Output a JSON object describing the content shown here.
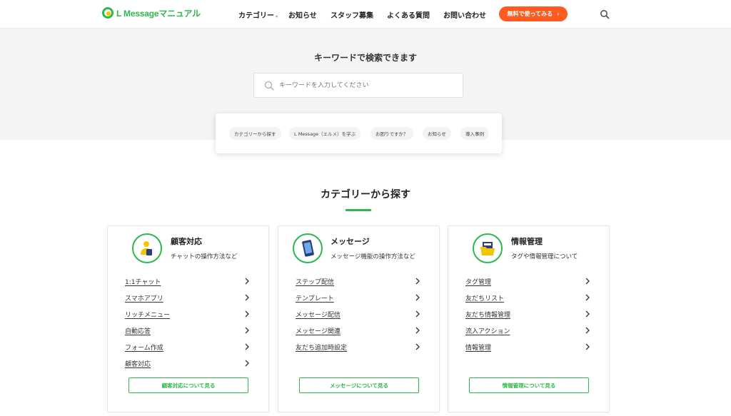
{
  "header": {
    "logo_text": "L Messageマニュアル",
    "nav": [
      {
        "label": "カテゴリー"
      },
      {
        "label": "お知らせ"
      },
      {
        "label": "スタッフ募集"
      },
      {
        "label": "よくある質問"
      },
      {
        "label": "お問い合わせ"
      }
    ],
    "cta_label": "無料で使ってみる",
    "cta_color": "#ff5a1f"
  },
  "hero": {
    "title": "キーワードで検索できます",
    "search_placeholder": "キーワードを入力してください",
    "tags": [
      {
        "label": "カテゴリーから探す"
      },
      {
        "label": "L Message（エルメ）を学ぶ"
      },
      {
        "label": "お困りですか？"
      },
      {
        "label": "お知らせ"
      },
      {
        "label": "導入事例"
      }
    ]
  },
  "section": {
    "title": "カテゴリーから探す",
    "accent": "#2db84b"
  },
  "cards": [
    {
      "name": "顧客対応",
      "desc": "チャットの操作方法など",
      "icon": "person-phone-icon",
      "links": [
        "1:1チャット",
        "スマホアプリ",
        "リッチメニュー",
        "自動応答",
        "フォーム作成",
        "顧客対応"
      ],
      "more": "顧客対応について見る"
    },
    {
      "name": "メッセージ",
      "desc": "メッセージ機能の操作方法など",
      "icon": "smartphone-icon",
      "links": [
        "ステップ配信",
        "テンプレート",
        "メッセージ配信",
        "メッセージ関連",
        "友だち追加時設定"
      ],
      "more": "メッセージについて見る"
    },
    {
      "name": "情報管理",
      "desc": "タグや情報管理について",
      "icon": "folder-icon",
      "links": [
        "タグ管理",
        "友だちリスト",
        "友だち情報管理",
        "流入アクション",
        "情報管理"
      ],
      "more": "情報管理について見る"
    }
  ]
}
